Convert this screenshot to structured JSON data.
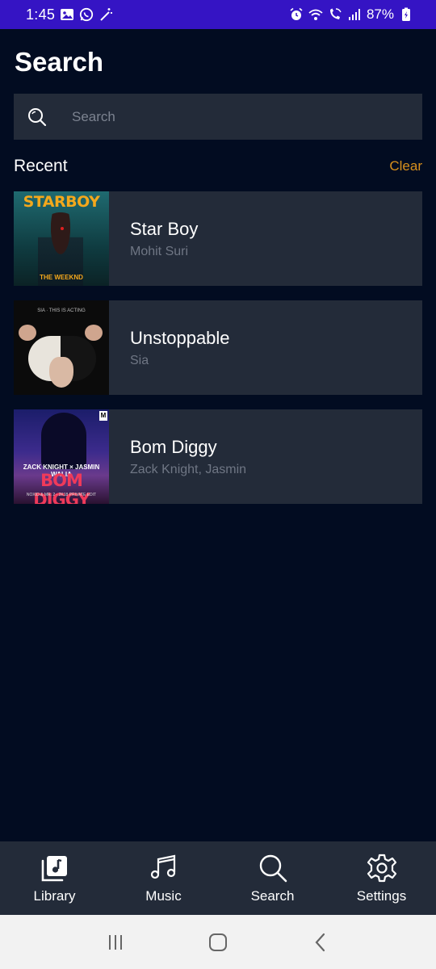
{
  "status_bar": {
    "time": "1:45",
    "battery": "87%",
    "left_icons": [
      "image-icon",
      "whatsapp-icon",
      "magic-wand-icon"
    ],
    "right_icons": [
      "alarm-icon",
      "wifi-icon",
      "wifi-calling-icon",
      "signal-icon",
      "battery-charging-icon"
    ],
    "background": "#3514c4"
  },
  "header": {
    "title": "Search"
  },
  "search": {
    "placeholder": "Search",
    "value": ""
  },
  "recent": {
    "label": "Recent",
    "clear_label": "Clear",
    "items": [
      {
        "title": "Star Boy",
        "subtitle": "Mohit Suri",
        "artwork": {
          "logo": "STARBOY",
          "tag": "THE WEEKND"
        }
      },
      {
        "title": "Unstoppable",
        "subtitle": "Sia",
        "artwork": {
          "caption": "SIA · THIS IS ACTING"
        }
      },
      {
        "title": "Bom Diggy",
        "subtitle": "Zack Knight, Jasmin",
        "artwork": {
          "artist": "ZACK KNIGHT × JASMIN WALIA",
          "title": "BOM DIGGY",
          "sub": "NOXID & MR. 2 - 2K18 PRIVATE EDIT",
          "badge": "M"
        }
      }
    ]
  },
  "bottom_nav": {
    "items": [
      {
        "label": "Library",
        "icon": "library-icon"
      },
      {
        "label": "Music",
        "icon": "music-notes-icon"
      },
      {
        "label": "Search",
        "icon": "search-icon"
      },
      {
        "label": "Settings",
        "icon": "gear-icon"
      }
    ]
  },
  "system_nav": {
    "buttons": [
      "recents-button",
      "home-button",
      "back-button"
    ]
  },
  "colors": {
    "background": "#020c21",
    "surface": "#232b39",
    "accent": "#d8901c",
    "muted_text": "#6f7684"
  }
}
